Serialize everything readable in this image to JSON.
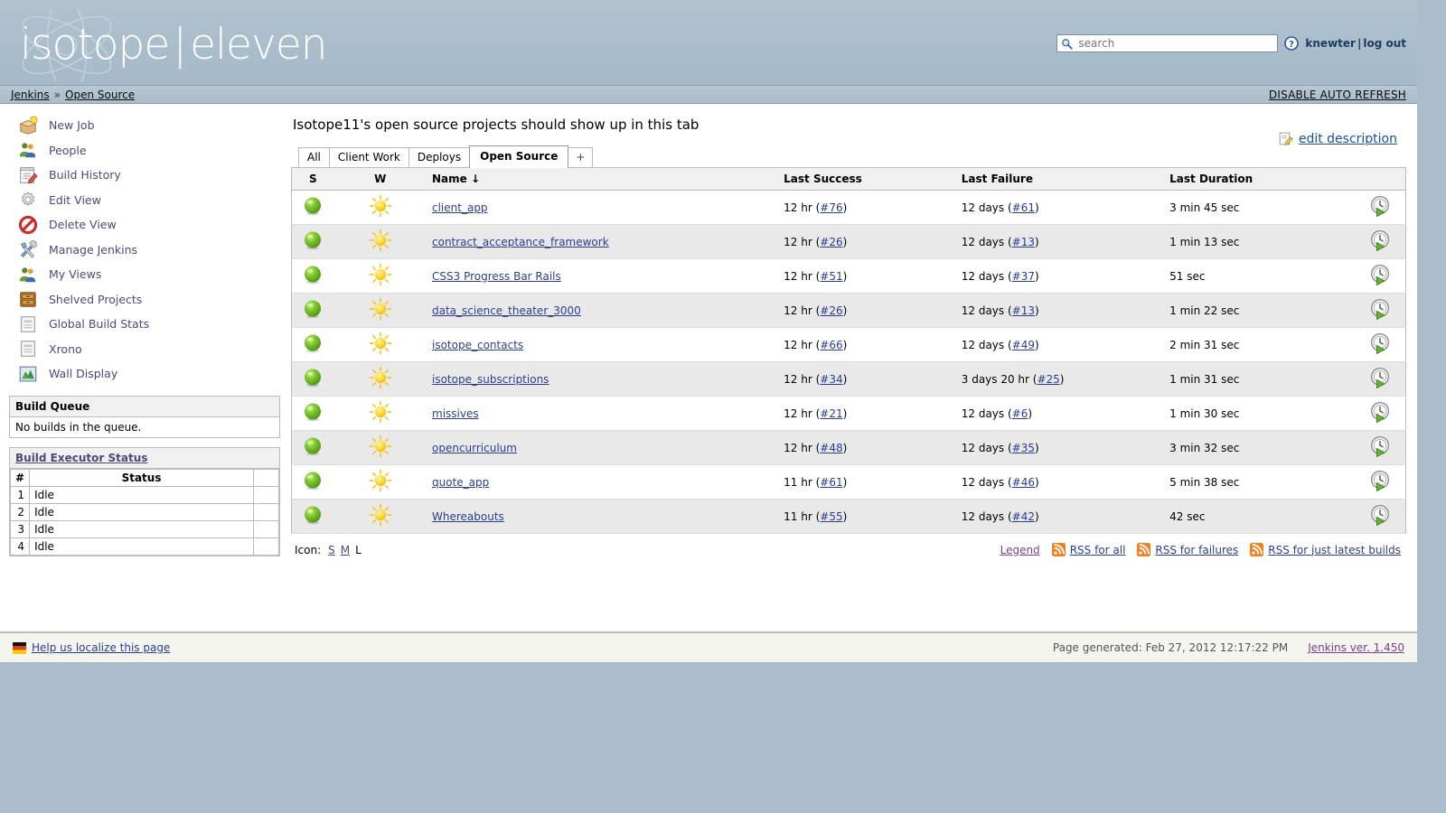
{
  "header": {
    "logo_primary": "isotope",
    "logo_divider": "|",
    "logo_secondary": "eleven",
    "search_placeholder": "search",
    "search_value": "",
    "user_name": "knewter",
    "user_separator": "|",
    "logout_label": "log out",
    "help_icon": "question-circle-icon",
    "search_icon": "search-icon"
  },
  "breadcrumb": {
    "root": "Jenkins",
    "separator": "»",
    "current": "Open Source",
    "auto_refresh": "DISABLE AUTO REFRESH"
  },
  "sidebar": {
    "items": [
      {
        "label": "New Job",
        "icon": "new-job-icon"
      },
      {
        "label": "People",
        "icon": "people-icon"
      },
      {
        "label": "Build History",
        "icon": "build-history-icon"
      },
      {
        "label": "Edit View",
        "icon": "gear-icon"
      },
      {
        "label": "Delete View",
        "icon": "delete-icon"
      },
      {
        "label": "Manage Jenkins",
        "icon": "tools-icon"
      },
      {
        "label": "My Views",
        "icon": "people-icon"
      },
      {
        "label": "Shelved Projects",
        "icon": "cabinet-icon"
      },
      {
        "label": "Global Build Stats",
        "icon": "document-icon"
      },
      {
        "label": "Xrono",
        "icon": "document-icon"
      },
      {
        "label": "Wall Display",
        "icon": "wall-display-icon"
      }
    ],
    "build_queue": {
      "title": "Build Queue",
      "empty_message": "No builds in the queue."
    },
    "executor_status": {
      "title": "Build Executor Status",
      "columns": [
        "#",
        "Status"
      ],
      "rows": [
        {
          "num": "1",
          "status": "Idle"
        },
        {
          "num": "2",
          "status": "Idle"
        },
        {
          "num": "3",
          "status": "Idle"
        },
        {
          "num": "4",
          "status": "Idle"
        }
      ]
    }
  },
  "main": {
    "view_description": "Isotope11's open source projects should show up in this tab",
    "edit_description_label": "edit description",
    "edit_description_icon": "edit-note-icon",
    "tabs": [
      {
        "label": "All",
        "active": false
      },
      {
        "label": "Client Work",
        "active": false
      },
      {
        "label": "Deploys",
        "active": false
      },
      {
        "label": "Open Source",
        "active": true
      },
      {
        "label": "+",
        "active": false
      }
    ],
    "table": {
      "columns": [
        "S",
        "W",
        "Name  ↓",
        "Last Success",
        "Last Failure",
        "Last Duration",
        ""
      ],
      "rows": [
        {
          "status": "green-ball-icon",
          "weather": "sunny-icon",
          "name": "client_app",
          "last_success_time": "12 hr",
          "last_success_build": "#76",
          "last_failure_time": "12 days",
          "last_failure_build": "#61",
          "last_duration": "3 min 45 sec",
          "action": "build-now-icon"
        },
        {
          "status": "green-ball-icon",
          "weather": "sunny-icon",
          "name": "contract_acceptance_framework",
          "last_success_time": "12 hr",
          "last_success_build": "#26",
          "last_failure_time": "12 days",
          "last_failure_build": "#13",
          "last_duration": "1 min 13 sec",
          "action": "build-now-icon"
        },
        {
          "status": "green-ball-icon",
          "weather": "sunny-icon",
          "name": "CSS3 Progress Bar Rails",
          "last_success_time": "12 hr",
          "last_success_build": "#51",
          "last_failure_time": "12 days",
          "last_failure_build": "#37",
          "last_duration": "51 sec",
          "action": "build-now-icon"
        },
        {
          "status": "green-ball-icon",
          "weather": "sunny-icon",
          "name": "data_science_theater_3000",
          "last_success_time": "12 hr",
          "last_success_build": "#26",
          "last_failure_time": "12 days",
          "last_failure_build": "#13",
          "last_duration": "1 min 22 sec",
          "action": "build-now-icon"
        },
        {
          "status": "green-ball-icon",
          "weather": "sunny-icon",
          "name": "isotope_contacts",
          "last_success_time": "12 hr",
          "last_success_build": "#66",
          "last_failure_time": "12 days",
          "last_failure_build": "#49",
          "last_duration": "2 min 31 sec",
          "action": "build-now-icon"
        },
        {
          "status": "green-ball-icon",
          "weather": "sunny-icon",
          "name": "isotope_subscriptions",
          "last_success_time": "12 hr",
          "last_success_build": "#34",
          "last_failure_time": "3 days 20 hr",
          "last_failure_build": "#25",
          "last_duration": "1 min 31 sec",
          "action": "build-now-icon"
        },
        {
          "status": "green-ball-icon",
          "weather": "sunny-icon",
          "name": "missives",
          "last_success_time": "12 hr",
          "last_success_build": "#21",
          "last_failure_time": "12 days",
          "last_failure_build": "#6",
          "last_duration": "1 min 30 sec",
          "action": "build-now-icon"
        },
        {
          "status": "green-ball-icon",
          "weather": "sunny-icon",
          "name": "opencurriculum",
          "last_success_time": "12 hr",
          "last_success_build": "#48",
          "last_failure_time": "12 days",
          "last_failure_build": "#35",
          "last_duration": "3 min 32 sec",
          "action": "build-now-icon"
        },
        {
          "status": "green-ball-icon",
          "weather": "sunny-icon",
          "name": "quote_app",
          "last_success_time": "11 hr",
          "last_success_build": "#61",
          "last_failure_time": "12 days",
          "last_failure_build": "#46",
          "last_duration": "5 min 38 sec",
          "action": "build-now-icon"
        },
        {
          "status": "green-ball-icon",
          "weather": "sunny-icon",
          "name": "Whereabouts",
          "last_success_time": "11 hr",
          "last_success_build": "#55",
          "last_failure_time": "12 days",
          "last_failure_build": "#42",
          "last_duration": "42 sec",
          "action": "build-now-icon"
        }
      ]
    },
    "icon_size": {
      "label": "Icon:",
      "small": "S",
      "medium": "M",
      "large": "L"
    },
    "feeds": {
      "legend": "Legend",
      "rss_all": "RSS for all",
      "rss_failures": "RSS for failures",
      "rss_latest": "RSS for just latest builds",
      "rss_icon": "rss-icon"
    }
  },
  "footer": {
    "localize_label": "Help us localize this page",
    "localize_icon": "flag-icon",
    "page_generated": "Page generated: Feb 27, 2012 12:17:22 PM",
    "version": "Jenkins ver. 1.450"
  },
  "colors": {
    "header_blue": "#a9bdcb",
    "link_blue": "#2a3f8f",
    "sidebar_link": "#4a4a7a",
    "status_green": "#6cc24a",
    "weather_yellow": "#f7d038",
    "rss_orange": "#f58020"
  }
}
